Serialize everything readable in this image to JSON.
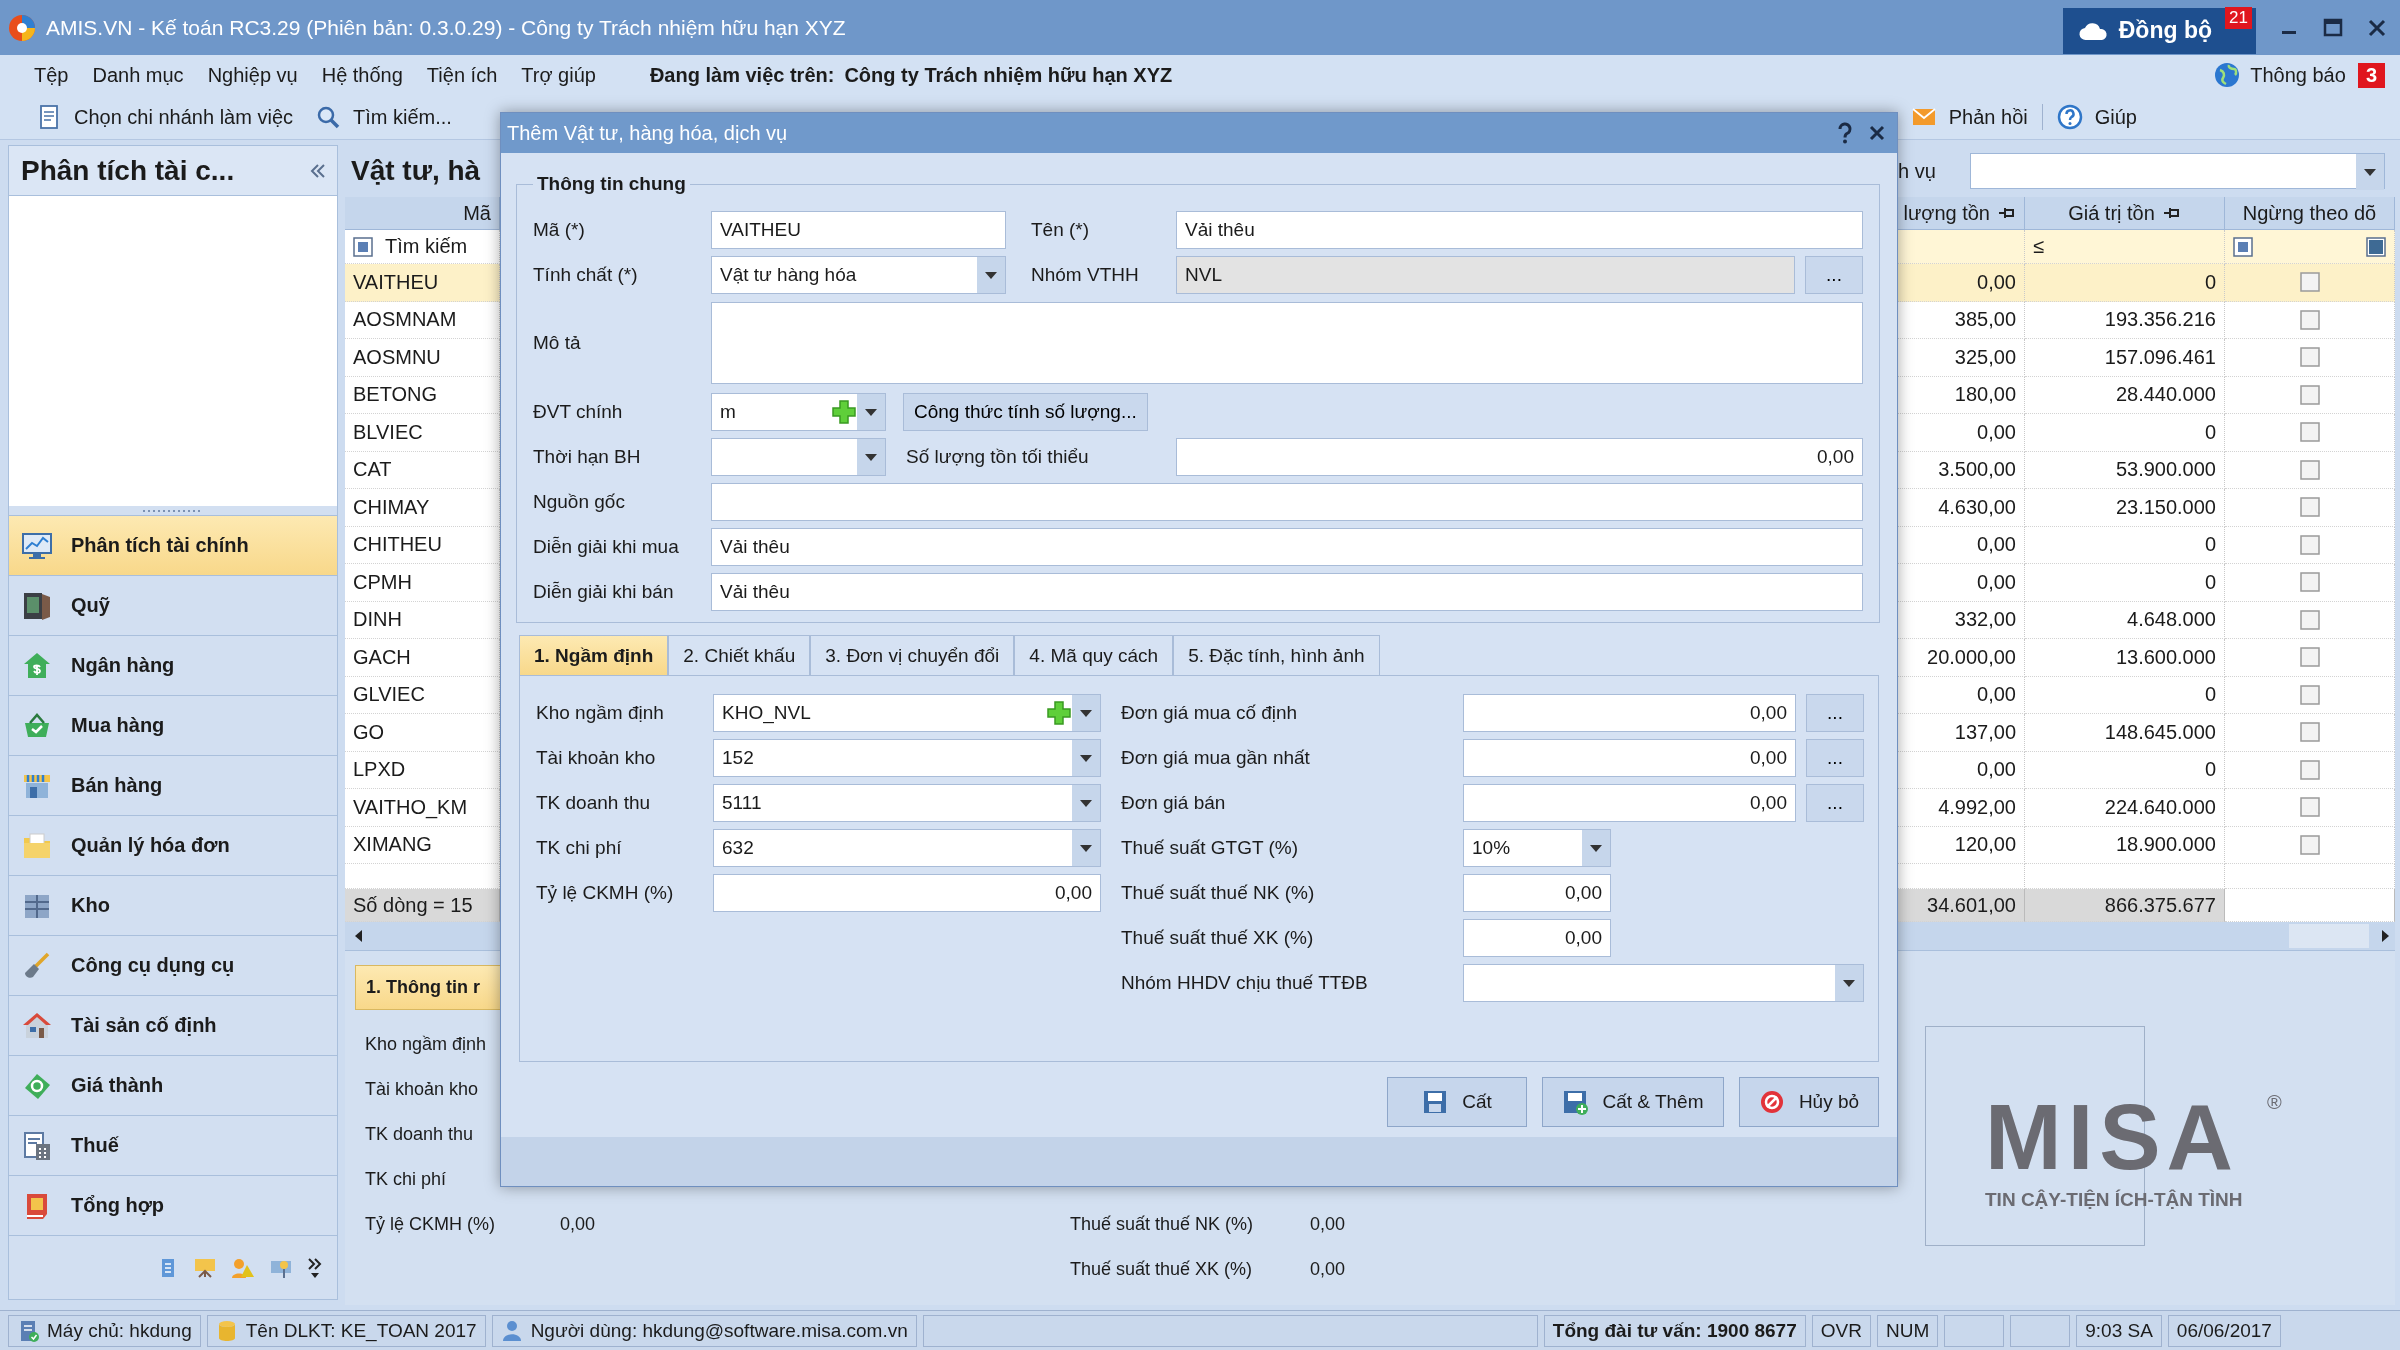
{
  "window": {
    "title": "AMIS.VN - Kế toán RC3.29 (Phiên bản: 0.3.0.29) - Công ty Trách nhiệm hữu hạn XYZ",
    "sync_button": {
      "label": "Đồng bộ",
      "badge": "21"
    }
  },
  "menu": {
    "items": [
      "Tệp",
      "Danh mục",
      "Nghiệp vụ",
      "Hệ thống",
      "Tiện ích",
      "Trợ giúp"
    ],
    "working_on": "Đang làm việc trên:",
    "company": "Công ty Trách nhiệm hữu hạn XYZ",
    "notifications": {
      "label": "Thông báo",
      "badge": "3"
    }
  },
  "toolbar": {
    "items": [
      {
        "label": "Chọn chi nhánh làm việc",
        "kind": "branch"
      },
      {
        "label": "Tìm kiếm...",
        "kind": "search"
      },
      {
        "label": "Phản hồi",
        "kind": "feedback"
      },
      {
        "label": "Giúp",
        "kind": "help"
      }
    ]
  },
  "sidebar": {
    "title": "Phân tích tài c...",
    "items": [
      {
        "label": "Phân tích tài chính",
        "selected": true
      },
      {
        "label": "Quỹ",
        "selected": false
      },
      {
        "label": "Ngân hàng",
        "selected": false
      },
      {
        "label": "Mua hàng",
        "selected": false
      },
      {
        "label": "Bán hàng",
        "selected": false
      },
      {
        "label": "Quản lý hóa đơn",
        "selected": false
      },
      {
        "label": "Kho",
        "selected": false
      },
      {
        "label": "Công cụ dụng cụ",
        "selected": false
      },
      {
        "label": "Tài sản cố định",
        "selected": false
      },
      {
        "label": "Giá thành",
        "selected": false
      },
      {
        "label": "Thuế",
        "selected": false
      },
      {
        "label": "Tổng hợp",
        "selected": false
      }
    ]
  },
  "list_panel": {
    "title": "Vật tư, hà",
    "filter_label": "h vụ",
    "grid": {
      "columns": [
        "Mã",
        "lượng tồn",
        "Giá trị tồn",
        "Ngừng theo dõ"
      ],
      "search_placeholder": "Tìm kiếm",
      "value_operator": "≤",
      "rows": [
        {
          "code": "VAITHEU",
          "quantity": "0,00",
          "value": "0",
          "stopped": false,
          "selected": true
        },
        {
          "code": "AOSMNAM",
          "quantity": "385,00",
          "value": "193.356.216",
          "stopped": false,
          "selected": false
        },
        {
          "code": "AOSMNU",
          "quantity": "325,00",
          "value": "157.096.461",
          "stopped": false,
          "selected": false
        },
        {
          "code": "BETONG",
          "quantity": "180,00",
          "value": "28.440.000",
          "stopped": false,
          "selected": false
        },
        {
          "code": "BLVIEC",
          "quantity": "0,00",
          "value": "0",
          "stopped": false,
          "selected": false
        },
        {
          "code": "CAT",
          "quantity": "3.500,00",
          "value": "53.900.000",
          "stopped": false,
          "selected": false
        },
        {
          "code": "CHIMAY",
          "quantity": "4.630,00",
          "value": "23.150.000",
          "stopped": false,
          "selected": false
        },
        {
          "code": "CHITHEU",
          "quantity": "0,00",
          "value": "0",
          "stopped": false,
          "selected": false
        },
        {
          "code": "CPMH",
          "quantity": "0,00",
          "value": "0",
          "stopped": false,
          "selected": false
        },
        {
          "code": "DINH",
          "quantity": "332,00",
          "value": "4.648.000",
          "stopped": false,
          "selected": false
        },
        {
          "code": "GACH",
          "quantity": "20.000,00",
          "value": "13.600.000",
          "stopped": false,
          "selected": false
        },
        {
          "code": "GLVIEC",
          "quantity": "0,00",
          "value": "0",
          "stopped": false,
          "selected": false
        },
        {
          "code": "GO",
          "quantity": "137,00",
          "value": "148.645.000",
          "stopped": false,
          "selected": false
        },
        {
          "code": "LPXD",
          "quantity": "0,00",
          "value": "0",
          "stopped": false,
          "selected": false
        },
        {
          "code": "VAITHO_KM",
          "quantity": "4.992,00",
          "value": "224.640.000",
          "stopped": false,
          "selected": false
        },
        {
          "code": "XIMANG",
          "quantity": "120,00",
          "value": "18.900.000",
          "stopped": false,
          "selected": false
        }
      ],
      "footer": {
        "count": "Số dòng = 15",
        "quantity": "34.601,00",
        "value": "866.375.677"
      }
    }
  },
  "detail_panel": {
    "tab": "1. Thông tin r",
    "rows": [
      {
        "label": "Kho ngầm định"
      },
      {
        "label": "Tài khoản kho"
      },
      {
        "label": "TK doanh thu"
      },
      {
        "label": "TK chi phí"
      },
      {
        "label": "Tỷ lệ CKMH (%)",
        "value": "0,00"
      }
    ],
    "tax_rows": [
      {
        "label": "Thuế suất thuế NK (%)",
        "value": "0,00"
      },
      {
        "label": "Thuế suất thuế XK (%)",
        "value": "0,00"
      }
    ]
  },
  "logo": {
    "text": "MISA",
    "mark": "®",
    "tagline": "TIN CẬY-TIỆN ÍCH-TẬN TÌNH"
  },
  "dialog": {
    "title": "Thêm Vật tư, hàng hóa, dịch vụ",
    "group_title": "Thông tin chung",
    "code": {
      "label": "Mã (*)",
      "value": "VAITHEU"
    },
    "name": {
      "label": "Tên (*)",
      "value": "Vải thêu"
    },
    "nature": {
      "label": "Tính chất (*)",
      "value": "Vật tư hàng hóa"
    },
    "group": {
      "label": "Nhóm VTHH",
      "value": "NVL",
      "disabled": true,
      "button": "..."
    },
    "description": {
      "label": "Mô tả"
    },
    "unit": {
      "label": "ĐVT chính",
      "value": "m"
    },
    "formula_button": "Công thức tính số lượng...",
    "warranty": {
      "label": "Thời hạn BH"
    },
    "min_stock": {
      "label": "Số lượng tồn tối thiểu",
      "value": "0,00"
    },
    "origin": {
      "label": "Nguồn gốc"
    },
    "purchase_description": {
      "label": "Diễn giải khi mua",
      "value": "Vải thêu"
    },
    "sale_description": {
      "label": "Diễn giải khi bán",
      "value": "Vải thêu"
    },
    "tabs": [
      {
        "label": "1. Ngầm định",
        "selected": true
      },
      {
        "label": "2. Chiết khấu",
        "selected": false
      },
      {
        "label": "3. Đơn vị chuyển đổi",
        "selected": false
      },
      {
        "label": "4. Mã quy cách",
        "selected": false
      },
      {
        "label": "5. Đặc tính, hình ảnh",
        "selected": false
      }
    ],
    "defaults_left": [
      {
        "label": "Kho ngầm định",
        "value": "KHO_NVL",
        "kind": "combo_add"
      },
      {
        "label": "Tài khoản kho",
        "value": "152",
        "kind": "combo"
      },
      {
        "label": "TK doanh thu",
        "value": "5111",
        "kind": "combo"
      },
      {
        "label": "TK chi phí",
        "value": "632",
        "kind": "combo"
      },
      {
        "label": "Tỷ lệ CKMH (%)",
        "value": "0,00",
        "kind": "number"
      }
    ],
    "defaults_right": [
      {
        "label": "Đơn giá mua cố định",
        "value": "0,00",
        "kind": "picker",
        "button": "..."
      },
      {
        "label": "Đơn giá mua gần nhất",
        "value": "0,00",
        "kind": "picker",
        "button": "..."
      },
      {
        "label": "Đơn giá bán",
        "value": "0,00",
        "kind": "picker",
        "button": "..."
      },
      {
        "label": "Thuế suất GTGT (%)",
        "value": "10%",
        "kind": "combo"
      },
      {
        "label": "Thuế suất thuế NK (%)",
        "value": "0,00",
        "kind": "number"
      },
      {
        "label": "Thuế suất thuế XK (%)",
        "value": "0,00",
        "kind": "number"
      },
      {
        "label": "Nhóm HHDV chịu thuế TTĐB",
        "kind": "wide_combo"
      }
    ],
    "buttons": [
      {
        "label": "Cất",
        "kind": "save"
      },
      {
        "label": "Cất & Thêm",
        "kind": "save_new"
      },
      {
        "label": "Hủy bỏ",
        "kind": "cancel"
      }
    ]
  },
  "status_bar": [
    {
      "kind": "server",
      "text": "Máy chủ: hkdung"
    },
    {
      "kind": "database",
      "text": "Tên DLKT: KE_TOAN 2017"
    },
    {
      "kind": "user",
      "text": "Người dùng: hkdung@software.misa.com.vn"
    },
    {
      "kind": "blank"
    },
    {
      "kind": "hotline",
      "text": "Tổng đài tư vấn: 1900 8677"
    },
    {
      "kind": "flag",
      "text": "OVR"
    },
    {
      "kind": "flag",
      "text": "NUM"
    },
    {
      "kind": "blank_small"
    },
    {
      "kind": "blank_small"
    },
    {
      "kind": "time",
      "text": "9:03 SA"
    },
    {
      "kind": "date",
      "text": "06/06/2017"
    }
  ]
}
